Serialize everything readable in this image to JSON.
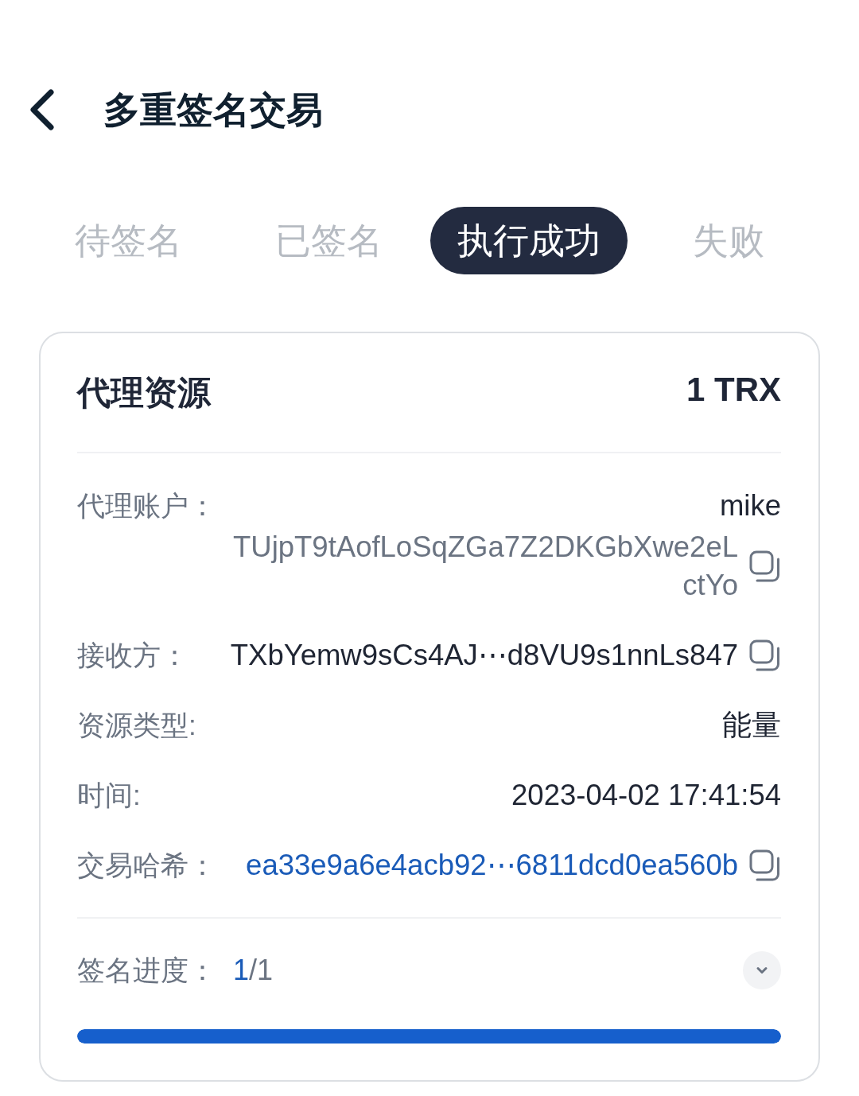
{
  "header": {
    "title": "多重签名交易"
  },
  "tabs": [
    {
      "label": "待签名",
      "selected": false
    },
    {
      "label": "已签名",
      "selected": false
    },
    {
      "label": "执行成功",
      "selected": true
    },
    {
      "label": "失败",
      "selected": false
    }
  ],
  "card": {
    "title": "代理资源",
    "amount": "1 TRX",
    "fields": [
      {
        "kind": "account",
        "label": "代理账户：",
        "name": "mike",
        "address": "TUjpT9tAofLoSqZGa7Z2DKGbXwe2eLctYo",
        "copyable": true
      },
      {
        "kind": "plain",
        "label": "接收方：",
        "value": "TXbYemw9sCs4AJ⋯d8VU9s1nnLs847",
        "copyable": true
      },
      {
        "kind": "plain",
        "label": "资源类型:",
        "value": "能量",
        "copyable": false
      },
      {
        "kind": "plain",
        "label": "时间:",
        "value": "2023-04-02 17:41:54",
        "copyable": false
      },
      {
        "kind": "link",
        "label": "交易哈希：",
        "value": "ea33e9a6e4acb92⋯6811dcd0ea560b",
        "copyable": true
      }
    ],
    "progress": {
      "label": "签名进度：",
      "signed": "1",
      "separator": "/",
      "total": "1",
      "level": 1,
      "expanded": false
    }
  }
}
